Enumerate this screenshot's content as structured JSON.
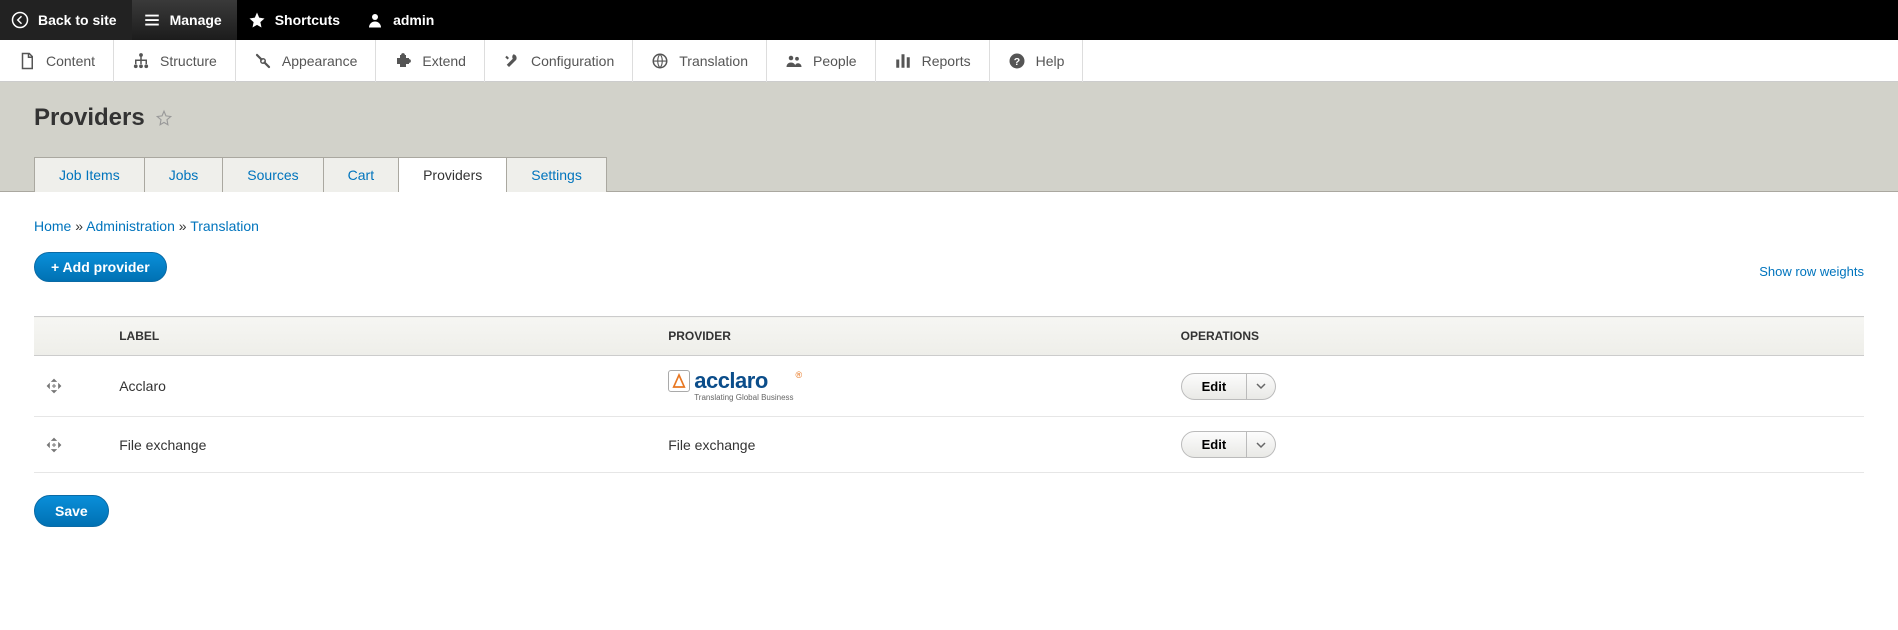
{
  "toolbar": {
    "back_to_site": "Back to site",
    "manage": "Manage",
    "shortcuts": "Shortcuts",
    "admin": "admin"
  },
  "admin_tabs": [
    {
      "label": "Content",
      "icon": "document-icon"
    },
    {
      "label": "Structure",
      "icon": "hierarchy-icon"
    },
    {
      "label": "Appearance",
      "icon": "wrench-icon"
    },
    {
      "label": "Extend",
      "icon": "puzzle-icon"
    },
    {
      "label": "Configuration",
      "icon": "tools-icon"
    },
    {
      "label": "Translation",
      "icon": "globe-icon"
    },
    {
      "label": "People",
      "icon": "people-icon"
    },
    {
      "label": "Reports",
      "icon": "barchart-icon"
    },
    {
      "label": "Help",
      "icon": "help-icon"
    }
  ],
  "page": {
    "title": "Providers"
  },
  "primary_tabs": [
    {
      "label": "Job Items",
      "active": false
    },
    {
      "label": "Jobs",
      "active": false
    },
    {
      "label": "Sources",
      "active": false
    },
    {
      "label": "Cart",
      "active": false
    },
    {
      "label": "Providers",
      "active": true
    },
    {
      "label": "Settings",
      "active": false
    }
  ],
  "breadcrumb": {
    "items": [
      "Home",
      "Administration",
      "Translation"
    ],
    "sep": "»"
  },
  "actions": {
    "add_provider": "+ Add provider",
    "show_row_weights": "Show row weights",
    "save": "Save"
  },
  "table": {
    "columns": [
      "LABEL",
      "PROVIDER",
      "OPERATIONS"
    ],
    "op_label": "Edit",
    "rows": [
      {
        "label": "Acclaro",
        "provider_display": "acclaro",
        "provider_tagline": "Translating Global Business",
        "is_logo": true
      },
      {
        "label": "File exchange",
        "provider_display": "File exchange",
        "provider_tagline": "",
        "is_logo": false
      }
    ]
  }
}
